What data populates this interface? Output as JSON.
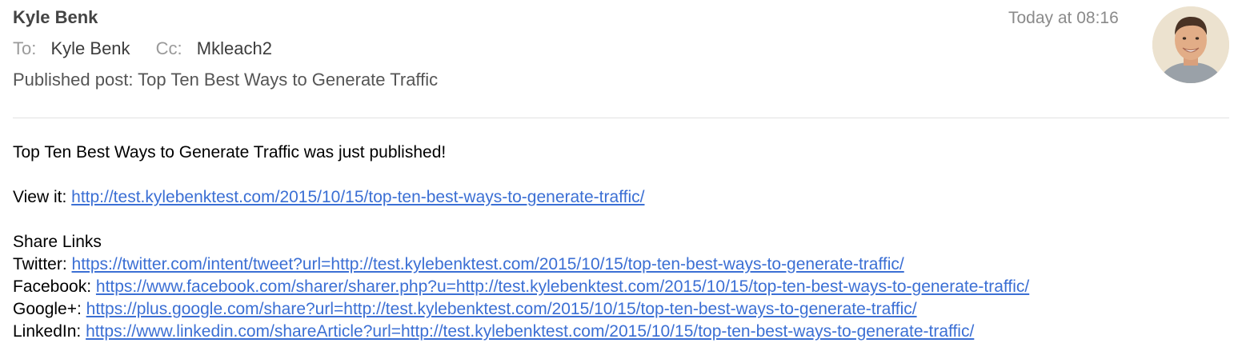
{
  "header": {
    "sender": "Kyle Benk",
    "timestamp": "Today at 08:16",
    "to_label": "To:",
    "to_value": "Kyle Benk",
    "cc_label": "Cc:",
    "cc_value": "Mkleach2",
    "subject": "Published post: Top Ten Best Ways to Generate Traffic"
  },
  "body": {
    "intro": "Top Ten Best Ways to Generate Traffic was just published!",
    "view_label": "View it:",
    "view_url": "http://test.kylebenktest.com/2015/10/15/top-ten-best-ways-to-generate-traffic/",
    "share_heading": "Share Links",
    "shares": [
      {
        "label": "Twitter:",
        "url": "https://twitter.com/intent/tweet?url=http://test.kylebenktest.com/2015/10/15/top-ten-best-ways-to-generate-traffic/"
      },
      {
        "label": "Facebook:",
        "url": "https://www.facebook.com/sharer/sharer.php?u=http://test.kylebenktest.com/2015/10/15/top-ten-best-ways-to-generate-traffic/"
      },
      {
        "label": "Google+:",
        "url": "https://plus.google.com/share?url=http://test.kylebenktest.com/2015/10/15/top-ten-best-ways-to-generate-traffic/"
      },
      {
        "label": "LinkedIn:",
        "url": "https://www.linkedin.com/shareArticle?url=http://test.kylebenktest.com/2015/10/15/top-ten-best-ways-to-generate-traffic/"
      }
    ]
  },
  "colors": {
    "link": "#3b6fd4",
    "divider": "#e2e2e2"
  }
}
